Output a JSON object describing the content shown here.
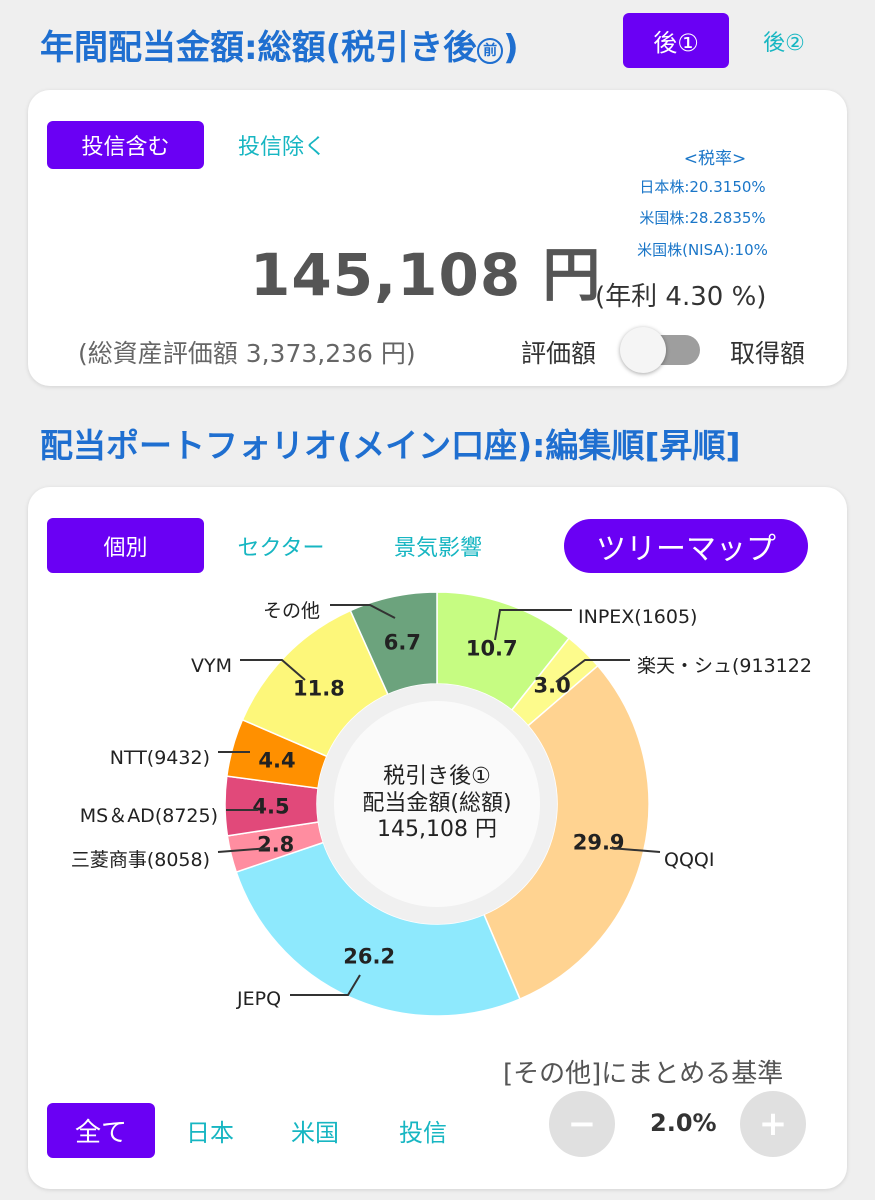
{
  "header": {
    "title": "年間配当金額:総額(税引き後",
    "title_icon": "前",
    "title_end": ")",
    "tab_after1": "後①",
    "tab_after2": "後②"
  },
  "summary": {
    "filter_include": "投信含む",
    "filter_exclude": "投信除く",
    "tax_title": "<税率>",
    "tax_japan": "日本株:20.3150%",
    "tax_us": "米国株:28.2835%",
    "tax_us_nisa": "米国株(NISA):10%",
    "amount": "145,108 円",
    "yield_text": "(年利 4.30 %)",
    "total_assets": "(総資産評価額 3,373,236 円)",
    "toggle_left": "評価額",
    "toggle_right": "取得額"
  },
  "portfolio": {
    "title": "配当ポートフォリオ(メイン口座):編集順[昇順]",
    "tab_individual": "個別",
    "tab_sector": "セクター",
    "tab_economy": "景気影響",
    "treemap_button": "ツリーマップ",
    "center_line1": "税引き後①",
    "center_line2": "配当金額(総額)",
    "center_line3": "145,108 円",
    "other_threshold_label": "[その他]にまとめる基準",
    "threshold_value": "2.0%",
    "minus": "−",
    "plus": "+",
    "filter_all": "全て",
    "filter_japan": "日本",
    "filter_us": "米国",
    "filter_fund": "投信"
  },
  "colors": {
    "accent": "#6a00f4",
    "title_blue": "#1f6fd0",
    "teal_text": "#17b6c2"
  },
  "chart_data": {
    "type": "pie",
    "donut": true,
    "slices": [
      {
        "name": "INPEX(1605)",
        "value": 10.7,
        "color": "#c6fc82"
      },
      {
        "name": "楽天・シュ(913122",
        "value": 3.0,
        "color": "#fdfb8c"
      },
      {
        "name": "QQQI",
        "value": 29.9,
        "color": "#ffd391"
      },
      {
        "name": "JEPQ",
        "value": 26.2,
        "color": "#8ee9fd"
      },
      {
        "name": "三菱商事(8058)",
        "value": 2.8,
        "color": "#ff8da0"
      },
      {
        "name": "MS＆AD(8725)",
        "value": 4.5,
        "color": "#e1497a"
      },
      {
        "name": "NTT(9432)",
        "value": 4.4,
        "color": "#ff9000"
      },
      {
        "name": "VYM",
        "value": 11.8,
        "color": "#fdf77a"
      },
      {
        "name": "その他",
        "value": 6.7,
        "color": "#6ca37d"
      }
    ]
  }
}
